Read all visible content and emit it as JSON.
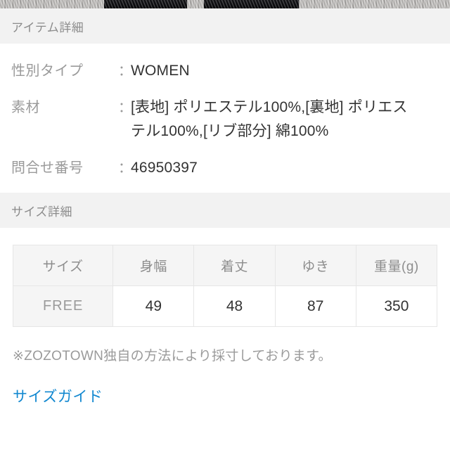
{
  "photo_strip": {
    "name": "product-photo-strip-cropped"
  },
  "item_detail": {
    "section_title": "アイテム詳細",
    "rows": [
      {
        "label": "性別タイプ",
        "colon": "：",
        "value": "WOMEN"
      },
      {
        "label": "素材",
        "colon": "：",
        "value": "[表地] ポリエステル100%,[裏地] ポリエステル100%,[リブ部分] 綿100%"
      },
      {
        "label": "問合せ番号",
        "colon": "：",
        "value": "46950397"
      }
    ]
  },
  "size_detail": {
    "section_title": "サイズ詳細",
    "table": {
      "headers": [
        "サイズ",
        "身幅",
        "着丈",
        "ゆき",
        "重量(g)"
      ],
      "rows": [
        [
          "FREE",
          "49",
          "48",
          "87",
          "350"
        ]
      ]
    },
    "note": "※ZOZOTOWN独自の方法により採寸しております。",
    "size_guide_link": "サイズガイド"
  },
  "colors": {
    "section_bar_bg": "#f2f2f2",
    "label_text": "#9a9a9a",
    "value_text": "#333333",
    "link_blue": "#1288d0",
    "table_border": "#e6e6e6",
    "table_header_bg": "#f5f5f5"
  }
}
